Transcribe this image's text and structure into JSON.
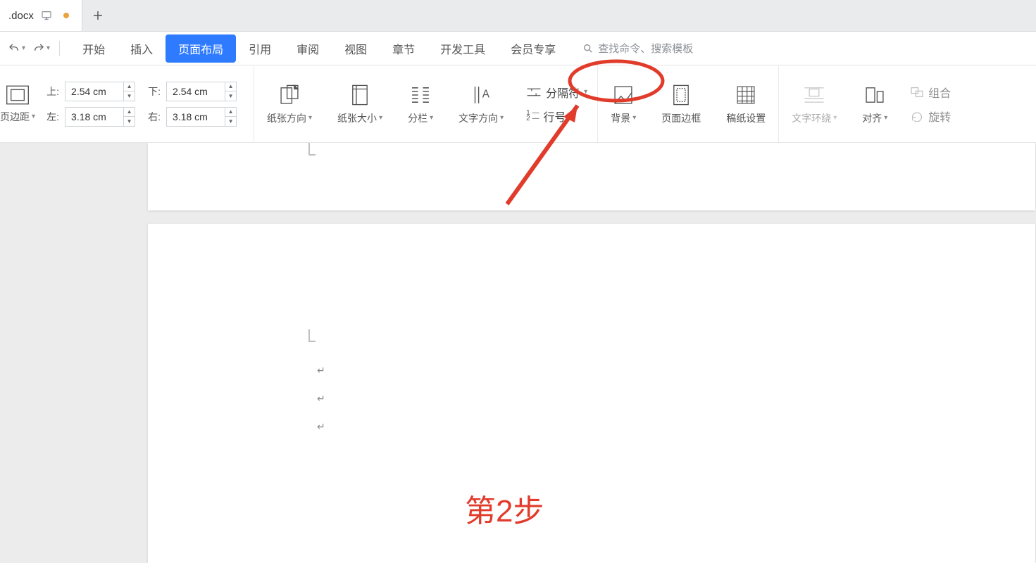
{
  "tab": {
    "filename": ".docx"
  },
  "qat": {
    "undo_name": "undo",
    "redo_name": "redo"
  },
  "ribbon_tabs": {
    "start": "开始",
    "insert": "插入",
    "page_layout": "页面布局",
    "references": "引用",
    "review": "审阅",
    "view": "视图",
    "sections": "章节",
    "developer": "开发工具",
    "member": "会员专享"
  },
  "search": {
    "placeholder": "查找命令、搜索模板"
  },
  "margins": {
    "cmd_label": "页边距",
    "top_label": "上:",
    "top_value": "2.54 cm",
    "bottom_label": "下:",
    "bottom_value": "2.54 cm",
    "left_label": "左:",
    "left_value": "3.18 cm",
    "right_label": "右:",
    "right_value": "3.18 cm"
  },
  "cmds": {
    "orientation": "纸张方向",
    "size": "纸张大小",
    "columns": "分栏",
    "text_direction": "文字方向",
    "breaks": "分隔符",
    "line_numbers": "行号",
    "background": "背景",
    "page_borders": "页面边框",
    "manuscript": "稿纸设置",
    "text_wrap": "文字环绕",
    "align": "对齐",
    "rotate": "旋转",
    "group": "组合"
  },
  "annotation": "第2步"
}
